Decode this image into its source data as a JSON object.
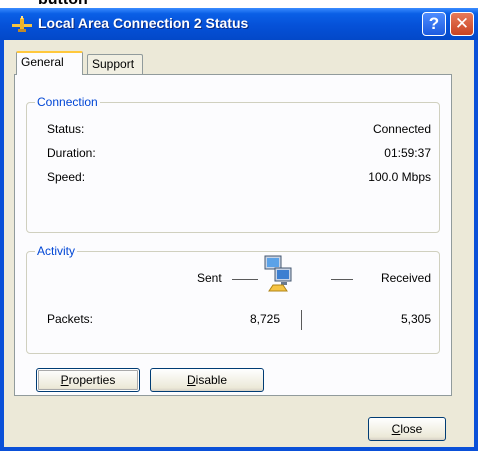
{
  "top_label": "button",
  "window": {
    "title": "Local Area Connection 2 Status",
    "help_glyph": "?",
    "close_glyph": "✕"
  },
  "tabs": [
    {
      "label": "General",
      "active": true
    },
    {
      "label": "Support",
      "active": false
    }
  ],
  "connection": {
    "legend": "Connection",
    "rows": [
      {
        "label": "Status:",
        "value": "Connected"
      },
      {
        "label": "Duration:",
        "value": "01:59:37"
      },
      {
        "label": "Speed:",
        "value": "100.0 Mbps"
      }
    ]
  },
  "activity": {
    "legend": "Activity",
    "sent_label": "Sent",
    "received_label": "Received",
    "packets_label": "Packets:",
    "packets_sent": "8,725",
    "packets_received": "5,305"
  },
  "buttons": {
    "properties_mnemonic": "P",
    "properties_rest": "roperties",
    "disable_mnemonic": "D",
    "disable_rest": "isable",
    "close_mnemonic": "C",
    "close_rest": "lose"
  },
  "colors": {
    "titlebar": "#0551d8",
    "group_legend": "#0046d5",
    "dialog_bg": "#ece9d8"
  },
  "icons": [
    "network-plug-icon",
    "help-icon",
    "close-icon",
    "network-activity-icon"
  ]
}
